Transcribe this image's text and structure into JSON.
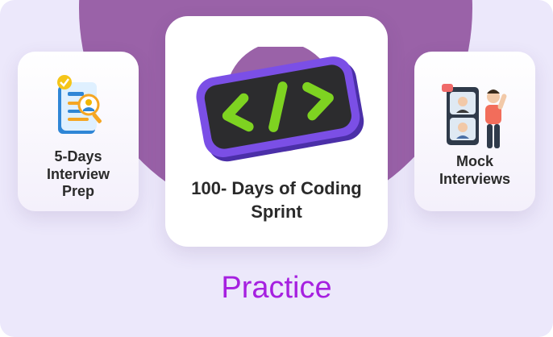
{
  "cards": {
    "left": {
      "label": "5-Days Interview Prep",
      "icon": "resume-icon"
    },
    "center": {
      "label": "100- Days of Coding Sprint",
      "icon": "code-icon"
    },
    "right": {
      "label": "Mock Interviews",
      "icon": "video-call-icon"
    }
  },
  "section_title": "Practice",
  "colors": {
    "background": "#ece8fb",
    "blob": "#9a62a8",
    "accent": "#a620e0",
    "card": "#ffffff",
    "code_frame": "#7b4fe6",
    "code_glyph": "#7ed321"
  }
}
